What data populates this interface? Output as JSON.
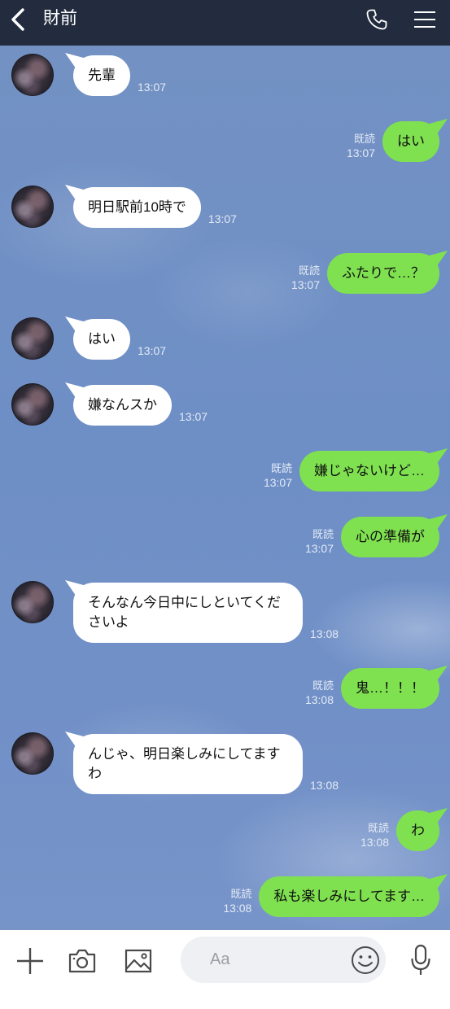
{
  "header": {
    "title": "財前",
    "icons": {
      "back": "chevron-left-icon",
      "call": "phone-icon",
      "menu": "hamburger-menu-icon"
    }
  },
  "messages": [
    {
      "outgoing": false,
      "text": "先輩",
      "time": "13:07"
    },
    {
      "outgoing": true,
      "text": "はい",
      "read": "既読",
      "time": "13:07"
    },
    {
      "outgoing": false,
      "text": "明日駅前10時で",
      "time": "13:07"
    },
    {
      "outgoing": true,
      "text": "ふたりで…？",
      "read": "既読",
      "time": "13:07"
    },
    {
      "outgoing": false,
      "text": "はい",
      "time": "13:07"
    },
    {
      "outgoing": false,
      "text": "嫌なんスか",
      "time": "13:07"
    },
    {
      "outgoing": true,
      "text": "嫌じゃないけど…",
      "read": "既読",
      "time": "13:07"
    },
    {
      "outgoing": true,
      "text": "心の準備が",
      "read": "既読",
      "time": "13:07"
    },
    {
      "outgoing": false,
      "text": "そんなん今日中にしといてくださいよ",
      "time": "13:08"
    },
    {
      "outgoing": true,
      "text": "鬼…！！！",
      "read": "既読",
      "time": "13:08"
    },
    {
      "outgoing": false,
      "text": "んじゃ、明日楽しみにしてますわ",
      "time": "13:08"
    },
    {
      "outgoing": true,
      "text": "わ",
      "read": "既読",
      "time": "13:08"
    },
    {
      "outgoing": true,
      "text": "私も楽しみにしてます…",
      "read": "既読",
      "time": "13:08"
    }
  ],
  "input_bar": {
    "placeholder": "Aa",
    "icons": {
      "attach": "plus-icon",
      "camera": "camera-icon",
      "gallery": "image-icon",
      "emoji": "smile-icon",
      "voice": "microphone-icon"
    }
  },
  "colors": {
    "header_bg": "#232c3f",
    "sent_bubble": "#7fe150",
    "received_bubble": "#ffffff",
    "meta_text": "#e3eaf5",
    "icon": "#4a4a4a"
  }
}
